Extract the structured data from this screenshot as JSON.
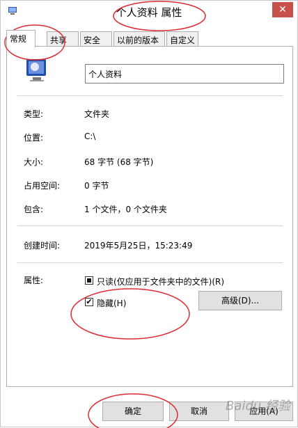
{
  "window": {
    "title": "个人资料 属性",
    "close_glyph": "✕"
  },
  "tabs": [
    {
      "label": "常规",
      "active": true
    },
    {
      "label": "共享"
    },
    {
      "label": "安全"
    },
    {
      "label": "以前的版本"
    },
    {
      "label": "自定义"
    }
  ],
  "general": {
    "name_value": "个人资料",
    "rows": [
      {
        "label": "类型:",
        "value": "文件夹"
      },
      {
        "label": "位置:",
        "value": "C:\\"
      },
      {
        "label": "大小:",
        "value": "68 字节 (68 字节)"
      },
      {
        "label": "占用空间:",
        "value": "0 字节"
      },
      {
        "label": "包含:",
        "value": "1 个文件，0 个文件夹"
      },
      {
        "label": "创建时间:",
        "value": "2019年5月25日，15:23:49"
      }
    ],
    "attributes_label": "属性:",
    "readonly_label": "只读(仅应用于文件夹中的文件)(R)",
    "readonly_state": "indeterminate",
    "hidden_label": "隐藏(H)",
    "hidden_checked": true,
    "check_glyph": "✔",
    "advanced_button": "高级(D)..."
  },
  "footer": {
    "ok": "确定",
    "cancel": "取消",
    "apply": "应用(A)"
  },
  "watermark": "Baidu 经验",
  "colors": {
    "annotation": "#e0282e",
    "close_button": "#c7504a"
  }
}
